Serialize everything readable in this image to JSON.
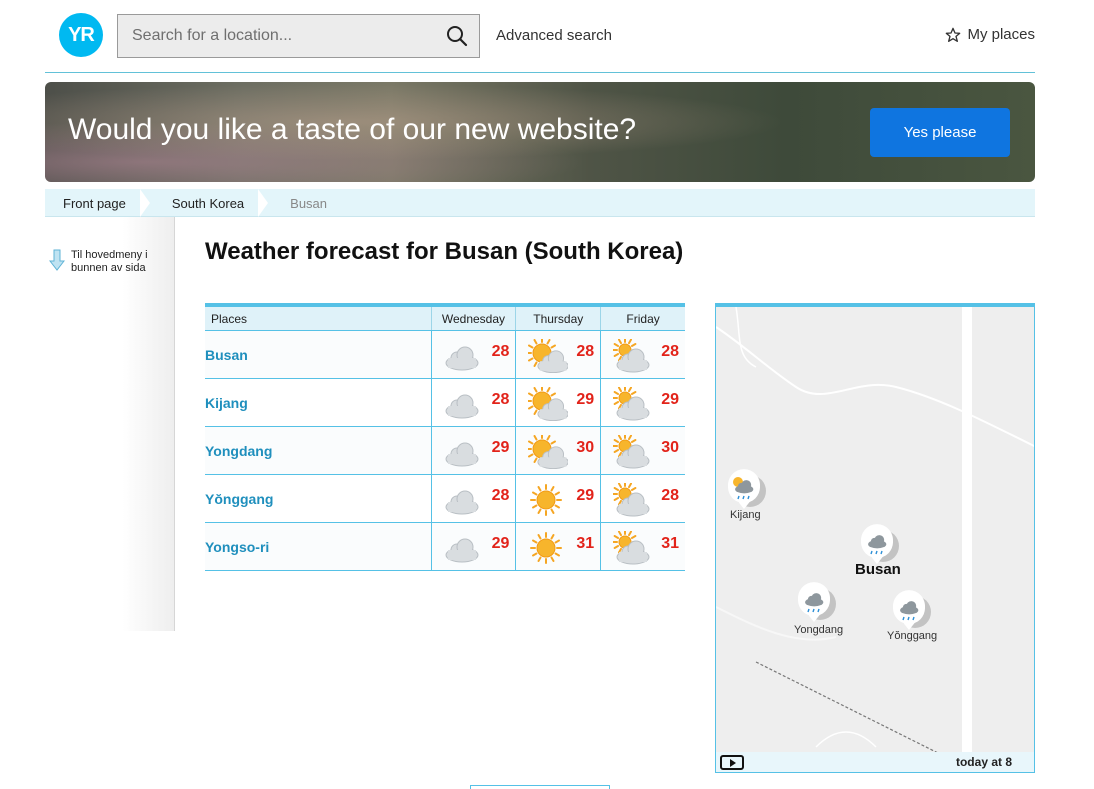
{
  "header": {
    "logo_text": "YR",
    "search_placeholder": "Search for a location...",
    "advanced_search": "Advanced search",
    "my_places": "My places"
  },
  "banner": {
    "headline": "Would you like a taste of our new website?",
    "button": "Yes please"
  },
  "breadcrumb": [
    "Front page",
    "South Korea",
    "Busan"
  ],
  "side_menu": {
    "link_line1": "Til hovedmeny i",
    "link_line2": "bunnen av sida"
  },
  "page_title": "Weather forecast for Busan (South Korea)",
  "table": {
    "headers": [
      "Places",
      "Wednesday",
      "Thursday",
      "Friday"
    ],
    "rows": [
      {
        "place": "Busan",
        "forecasts": [
          {
            "icon": "cloudy",
            "temp": "28"
          },
          {
            "icon": "partly-sunny",
            "temp": "28"
          },
          {
            "icon": "fair",
            "temp": "28"
          }
        ]
      },
      {
        "place": "Kijang",
        "forecasts": [
          {
            "icon": "cloudy",
            "temp": "28"
          },
          {
            "icon": "partly-sunny",
            "temp": "29"
          },
          {
            "icon": "fair",
            "temp": "29"
          }
        ]
      },
      {
        "place": "Yongdang",
        "forecasts": [
          {
            "icon": "cloudy",
            "temp": "29"
          },
          {
            "icon": "partly-sunny",
            "temp": "30"
          },
          {
            "icon": "fair",
            "temp": "30"
          }
        ]
      },
      {
        "place": "Yŏnggang",
        "forecasts": [
          {
            "icon": "cloudy",
            "temp": "28"
          },
          {
            "icon": "sun",
            "temp": "29"
          },
          {
            "icon": "fair",
            "temp": "28"
          }
        ]
      },
      {
        "place": "Yongso-ri",
        "forecasts": [
          {
            "icon": "cloudy",
            "temp": "29"
          },
          {
            "icon": "sun",
            "temp": "31"
          },
          {
            "icon": "fair",
            "temp": "31"
          }
        ]
      }
    ]
  },
  "map": {
    "pins": [
      {
        "label": "Kijang",
        "icon": "rain-sun-icon"
      },
      {
        "label": "Busan",
        "icon": "rain-icon"
      },
      {
        "label": "Yongdang",
        "icon": "rain-icon"
      },
      {
        "label": "Yŏnggang",
        "icon": "rain-icon"
      }
    ],
    "time_label": "today at 8"
  },
  "colors": {
    "accent": "#55c1e6",
    "link": "#1f8fbd",
    "temp": "#e2231a",
    "cta": "#0f75e0"
  }
}
